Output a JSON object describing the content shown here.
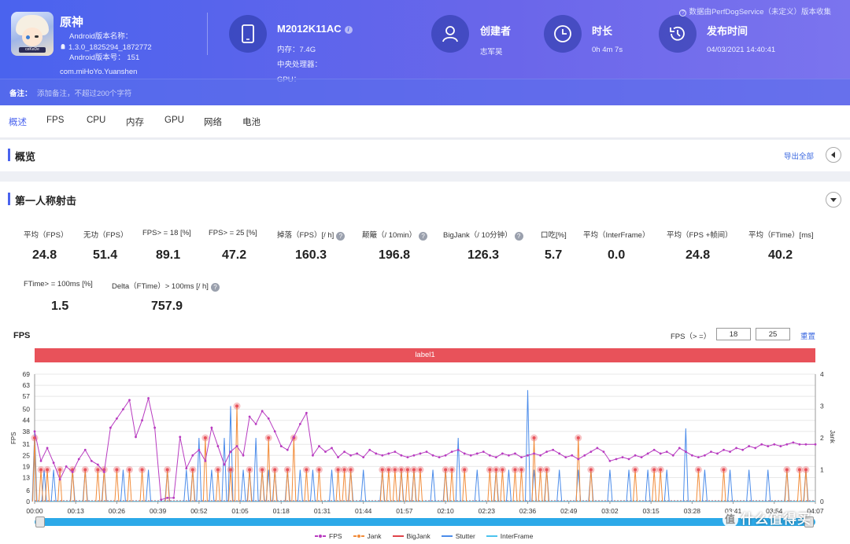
{
  "app": {
    "name": "原神",
    "version_label": "Android版本名称：",
    "version_name": "1.3.0_1825294_1872772",
    "version_code_label": "Android版本号：",
    "version_code": "151",
    "package": "com.miHoYo.Yuanshen",
    "icon_tag": "ceKeDe"
  },
  "device": {
    "model": "M2012K11AC",
    "memory": "内存：7.4G",
    "cpu": "中央处理器：",
    "gpu": "GPU："
  },
  "creator": {
    "label": "创建者",
    "value": "志军吴"
  },
  "duration": {
    "label": "时长",
    "value": "0h 4m 7s"
  },
  "publish": {
    "label": "发布时间",
    "value": "04/03/2021 14:40:41"
  },
  "collect_note": "数据由PerfDogService（未定义）版本收集",
  "note": {
    "label": "备注：",
    "placeholder": "添加备注，不超过200个字符"
  },
  "tabs": [
    "概述",
    "FPS",
    "CPU",
    "内存",
    "GPU",
    "网络",
    "电池"
  ],
  "overview": {
    "title": "概览",
    "export": "导出全部"
  },
  "section": {
    "title": "第一人称射击"
  },
  "metrics_row1": [
    {
      "label": "平均（FPS）",
      "value": "24.8",
      "help": false
    },
    {
      "label": "无功（FPS）",
      "value": "51.4",
      "help": false
    },
    {
      "label": "FPS> = 18 [%]",
      "value": "89.1",
      "help": false
    },
    {
      "label": "FPS> = 25 [%]",
      "value": "47.2",
      "help": false
    },
    {
      "label": "掉落（FPS）[/ h]",
      "value": "160.3",
      "help": true
    },
    {
      "label": "颠簸（/ 10min）",
      "value": "196.8",
      "help": true
    },
    {
      "label": "BigJank（/ 10分钟）",
      "value": "126.3",
      "help": true
    },
    {
      "label": "口吃[%]",
      "value": "5.7",
      "help": false
    },
    {
      "label": "平均（InterFrame）",
      "value": "0.0",
      "help": false
    },
    {
      "label": "平均（FPS +帧间）",
      "value": "24.8",
      "help": false
    },
    {
      "label": "平均（FTime）[ms]",
      "value": "40.2",
      "help": false
    }
  ],
  "metrics_row2": [
    {
      "label": "FTime> = 100ms [%]",
      "value": "1.5",
      "help": false
    },
    {
      "label": "Delta（FTime）> 100ms [/ h]",
      "value": "757.9",
      "help": true
    }
  ],
  "fps_chart": {
    "caption": "FPS",
    "filter_label": "FPS（> =）",
    "threshold_low": "18",
    "threshold_high": "25",
    "reset": "重置",
    "band_label": "label1"
  },
  "chart_data": {
    "type": "line",
    "ylabel": "FPS",
    "ylabel_right": "Jank",
    "y_ticks": [
      0,
      6,
      13,
      19,
      25,
      31,
      38,
      44,
      50,
      57,
      63,
      69
    ],
    "y_ticks_right": [
      0,
      1,
      2,
      3,
      4
    ],
    "ylim": [
      0,
      69
    ],
    "ylim_right": [
      0,
      4
    ],
    "x_ticks": [
      "00:00",
      "00:13",
      "00:26",
      "00:39",
      "00:52",
      "01:05",
      "01:18",
      "01:31",
      "01:44",
      "01:57",
      "02:10",
      "02:23",
      "02:36",
      "02:49",
      "03:02",
      "03:15",
      "03:28",
      "03:41",
      "03:54",
      "04:07"
    ],
    "x_range_seconds": [
      0,
      247
    ],
    "fps_keypoints": [
      [
        0,
        38
      ],
      [
        2,
        22
      ],
      [
        4,
        29
      ],
      [
        6,
        21
      ],
      [
        8,
        12
      ],
      [
        10,
        19
      ],
      [
        12,
        16
      ],
      [
        14,
        23
      ],
      [
        16,
        28
      ],
      [
        18,
        22
      ],
      [
        20,
        20
      ],
      [
        22,
        16
      ],
      [
        24,
        40
      ],
      [
        26,
        45
      ],
      [
        28,
        50
      ],
      [
        30,
        55
      ],
      [
        32,
        35
      ],
      [
        34,
        44
      ],
      [
        36,
        56
      ],
      [
        38,
        40
      ],
      [
        40,
        1
      ],
      [
        42,
        2
      ],
      [
        44,
        2
      ],
      [
        46,
        35
      ],
      [
        48,
        18
      ],
      [
        50,
        25
      ],
      [
        52,
        28
      ],
      [
        54,
        22
      ],
      [
        56,
        40
      ],
      [
        58,
        30
      ],
      [
        60,
        20
      ],
      [
        62,
        27
      ],
      [
        64,
        30
      ],
      [
        66,
        25
      ],
      [
        68,
        46
      ],
      [
        70,
        42
      ],
      [
        72,
        49
      ],
      [
        74,
        45
      ],
      [
        76,
        38
      ],
      [
        78,
        30
      ],
      [
        80,
        28
      ],
      [
        82,
        35
      ],
      [
        84,
        42
      ],
      [
        86,
        48
      ],
      [
        88,
        25
      ],
      [
        90,
        30
      ],
      [
        92,
        27
      ],
      [
        94,
        29
      ],
      [
        96,
        24
      ],
      [
        98,
        27
      ],
      [
        100,
        25
      ],
      [
        102,
        26
      ],
      [
        104,
        24
      ],
      [
        106,
        28
      ],
      [
        108,
        26
      ],
      [
        110,
        25
      ],
      [
        112,
        26
      ],
      [
        114,
        27
      ],
      [
        116,
        25
      ],
      [
        118,
        24
      ],
      [
        120,
        25
      ],
      [
        122,
        26
      ],
      [
        124,
        27
      ],
      [
        126,
        25
      ],
      [
        128,
        24
      ],
      [
        130,
        25
      ],
      [
        132,
        27
      ],
      [
        134,
        28
      ],
      [
        136,
        26
      ],
      [
        138,
        25
      ],
      [
        140,
        26
      ],
      [
        142,
        27
      ],
      [
        144,
        25
      ],
      [
        146,
        24
      ],
      [
        148,
        26
      ],
      [
        150,
        25
      ],
      [
        152,
        26
      ],
      [
        154,
        24
      ],
      [
        156,
        25
      ],
      [
        158,
        26
      ],
      [
        160,
        25
      ],
      [
        162,
        27
      ],
      [
        164,
        28
      ],
      [
        166,
        26
      ],
      [
        168,
        24
      ],
      [
        170,
        25
      ],
      [
        172,
        23
      ],
      [
        174,
        25
      ],
      [
        176,
        27
      ],
      [
        178,
        29
      ],
      [
        180,
        27
      ],
      [
        182,
        22
      ],
      [
        184,
        23
      ],
      [
        186,
        24
      ],
      [
        188,
        23
      ],
      [
        190,
        25
      ],
      [
        192,
        24
      ],
      [
        194,
        26
      ],
      [
        196,
        28
      ],
      [
        198,
        26
      ],
      [
        200,
        27
      ],
      [
        202,
        25
      ],
      [
        204,
        29
      ],
      [
        206,
        27
      ],
      [
        208,
        25
      ],
      [
        210,
        24
      ],
      [
        212,
        25
      ],
      [
        214,
        27
      ],
      [
        216,
        26
      ],
      [
        218,
        28
      ],
      [
        220,
        27
      ],
      [
        222,
        29
      ],
      [
        224,
        28
      ],
      [
        226,
        30
      ],
      [
        228,
        29
      ],
      [
        230,
        31
      ],
      [
        232,
        30
      ],
      [
        234,
        31
      ],
      [
        236,
        30
      ],
      [
        238,
        31
      ],
      [
        240,
        32
      ],
      [
        242,
        31
      ],
      [
        244,
        31
      ],
      [
        247,
        31
      ]
    ],
    "jank_points": [
      [
        0,
        2
      ],
      [
        2,
        1
      ],
      [
        4,
        1
      ],
      [
        8,
        1
      ],
      [
        12,
        1
      ],
      [
        16,
        1
      ],
      [
        20,
        1
      ],
      [
        22,
        1
      ],
      [
        26,
        1
      ],
      [
        30,
        1
      ],
      [
        34,
        1
      ],
      [
        42,
        1
      ],
      [
        50,
        1
      ],
      [
        54,
        2
      ],
      [
        58,
        1
      ],
      [
        62,
        1
      ],
      [
        64,
        3
      ],
      [
        68,
        1
      ],
      [
        72,
        1
      ],
      [
        74,
        2
      ],
      [
        76,
        1
      ],
      [
        80,
        1
      ],
      [
        82,
        2
      ],
      [
        86,
        1
      ],
      [
        90,
        1
      ],
      [
        96,
        1
      ],
      [
        98,
        1
      ],
      [
        100,
        1
      ],
      [
        110,
        1
      ],
      [
        112,
        1
      ],
      [
        114,
        1
      ],
      [
        116,
        1
      ],
      [
        118,
        1
      ],
      [
        120,
        1
      ],
      [
        122,
        1
      ],
      [
        130,
        1
      ],
      [
        132,
        1
      ],
      [
        136,
        1
      ],
      [
        144,
        1
      ],
      [
        146,
        1
      ],
      [
        148,
        1
      ],
      [
        152,
        1
      ],
      [
        154,
        1
      ],
      [
        158,
        2
      ],
      [
        160,
        1
      ],
      [
        162,
        1
      ],
      [
        172,
        2
      ],
      [
        176,
        1
      ],
      [
        190,
        1
      ],
      [
        196,
        1
      ],
      [
        198,
        1
      ],
      [
        210,
        1
      ],
      [
        218,
        1
      ],
      [
        238,
        1
      ],
      [
        242,
        1
      ],
      [
        244,
        1
      ]
    ],
    "stutter_points": [
      [
        0,
        2.2
      ],
      [
        3,
        1
      ],
      [
        6,
        1
      ],
      [
        12,
        1
      ],
      [
        16,
        1
      ],
      [
        22,
        1
      ],
      [
        28,
        1
      ],
      [
        36,
        1
      ],
      [
        42,
        1
      ],
      [
        48,
        1
      ],
      [
        50,
        1
      ],
      [
        52,
        2
      ],
      [
        56,
        1
      ],
      [
        60,
        2
      ],
      [
        62,
        3
      ],
      [
        66,
        1
      ],
      [
        68,
        1
      ],
      [
        70,
        2
      ],
      [
        72,
        1
      ],
      [
        74,
        1
      ],
      [
        76,
        1
      ],
      [
        80,
        1
      ],
      [
        84,
        1
      ],
      [
        88,
        1
      ],
      [
        94,
        1
      ],
      [
        100,
        1
      ],
      [
        104,
        1
      ],
      [
        110,
        1
      ],
      [
        116,
        1
      ],
      [
        120,
        1
      ],
      [
        126,
        1
      ],
      [
        130,
        1
      ],
      [
        134,
        2
      ],
      [
        140,
        1
      ],
      [
        146,
        1
      ],
      [
        150,
        1
      ],
      [
        156,
        3.5
      ],
      [
        158,
        1
      ],
      [
        162,
        1
      ],
      [
        166,
        1
      ],
      [
        172,
        1
      ],
      [
        176,
        1
      ],
      [
        182,
        1
      ],
      [
        188,
        1
      ],
      [
        194,
        1
      ],
      [
        200,
        1
      ],
      [
        206,
        2.3
      ],
      [
        212,
        1
      ],
      [
        220,
        1
      ],
      [
        226,
        1
      ],
      [
        232,
        1
      ],
      [
        238,
        1
      ],
      [
        244,
        1
      ]
    ],
    "series": [
      {
        "name": "FPS",
        "color": "#b83bc0"
      },
      {
        "name": "Jank",
        "color": "#f28c3a"
      },
      {
        "name": "BigJank",
        "color": "#e0434a"
      },
      {
        "name": "Stutter",
        "color": "#4b8cea"
      },
      {
        "name": "InterFrame",
        "color": "#4cc3ee"
      }
    ]
  },
  "watermark": "值 什么值得买",
  "colors": {
    "accent": "#4a63ee",
    "band": "#e8525a",
    "scroll": "#2ca9e8"
  }
}
